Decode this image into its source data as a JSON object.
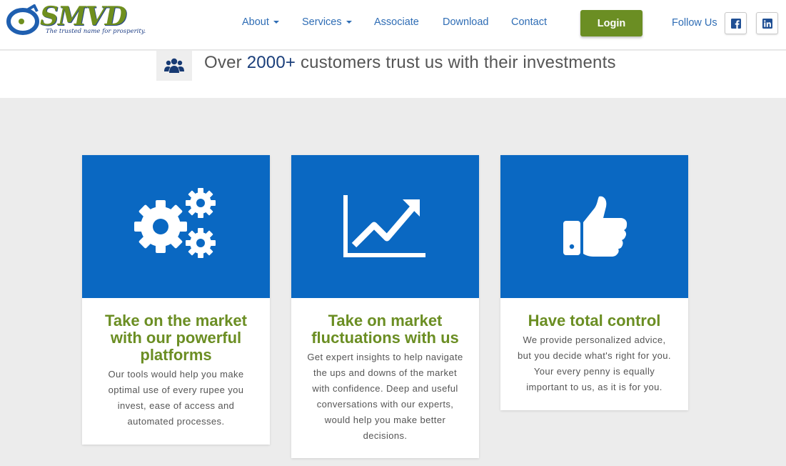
{
  "brand": {
    "name": "SMVD",
    "tagline": "The trusted name for prosperity."
  },
  "nav": {
    "items": [
      {
        "label": "About",
        "dropdown": true
      },
      {
        "label": "Services",
        "dropdown": true
      },
      {
        "label": "Associate",
        "dropdown": false
      },
      {
        "label": "Download",
        "dropdown": false
      },
      {
        "label": "Contact",
        "dropdown": false
      }
    ],
    "login_label": "Login",
    "follow_label": "Follow Us",
    "social": [
      {
        "icon": "facebook-icon"
      },
      {
        "icon": "linkedin-icon"
      }
    ]
  },
  "trust": {
    "icon": "users-icon",
    "prefix": "Over",
    "number": "2000+",
    "suffix": "customers trust us with their investments"
  },
  "cards": [
    {
      "icon": "gears-icon",
      "title": "Take on the market with our powerful platforms",
      "text": "Our tools would help you make optimal use of every rupee you invest, ease of access and automated processes."
    },
    {
      "icon": "chart-line-icon",
      "title": "Take on market fluctuations with us",
      "text": "Get expert insights to help navigate the ups and downs of the market with confidence. Deep and useful conversations with our experts, would help you make better decisions."
    },
    {
      "icon": "thumbs-up-icon",
      "title": "Have total control",
      "text": "We provide personalized advice, but you decide what's right for you. Your every penny is equally important to us, as it is for you."
    }
  ],
  "colors": {
    "brand_green": "#6b8e23",
    "link_blue": "#2f6db5",
    "card_blue": "#0a68c2",
    "dark_navy": "#1a3e7a",
    "page_bg": "#ececec"
  }
}
